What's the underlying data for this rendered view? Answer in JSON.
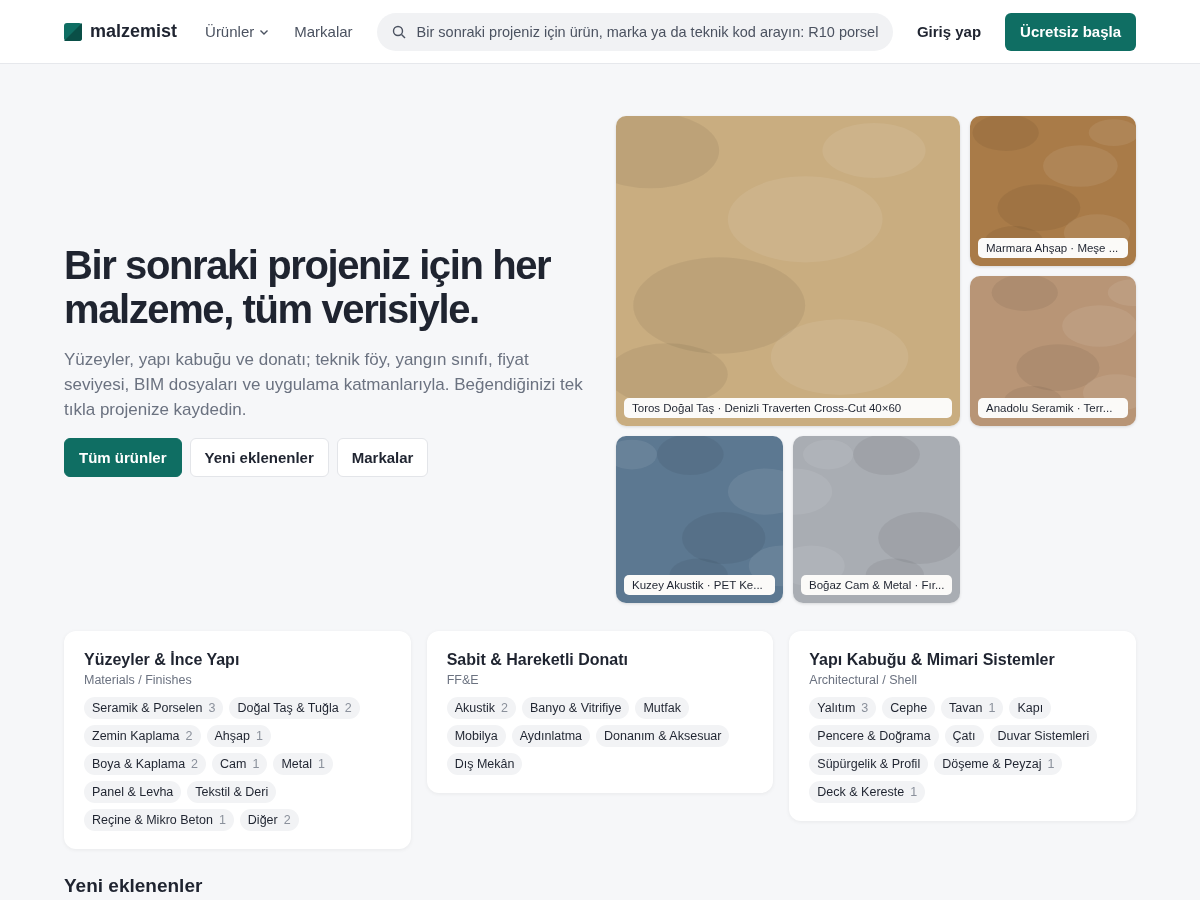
{
  "header": {
    "logo": "malzemist",
    "nav": [
      {
        "label": "Ürünler",
        "dropdown": true
      },
      {
        "label": "Markalar",
        "dropdown": false
      }
    ],
    "search": {
      "placeholder": "Bir sonraki projeniz için ürün, marka ya da teknik kod arayın: R10 porsel"
    },
    "login": "Giriş yap",
    "cta": "Ücretsiz başla"
  },
  "hero": {
    "title": "Bir sonraki projeniz için her malzeme, tüm verisiyle.",
    "text": "Yüzeyler, yapı kabuğu ve donatı; teknik föy, yangın sınıfı, fiyat seviyesi, BIM dosyaları ve uygulama katmanlarıyla. Beğendiğinizi tek tıkla projenize kaydedin.",
    "buttons": [
      {
        "label": "Tüm ürünler",
        "primary": true
      },
      {
        "label": "Yeni eklenenler",
        "primary": false
      },
      {
        "label": "Markalar",
        "primary": false
      }
    ]
  },
  "gallery": [
    {
      "kind": "picture",
      "caption": "Toros Doğal Taş · Denizli Traverten Cross-Cut 40×60"
    },
    {
      "kind": "picture",
      "caption": "Marmara Ahşap · Meşe ..."
    },
    {
      "kind": "picture",
      "caption": "Anadolu Seramik · Terr..."
    },
    {
      "kind": "picture",
      "caption": "Kuzey Akustik · PET Ke..."
    },
    {
      "kind": "picture",
      "caption": "Boğaz Cam & Metal · Fır..."
    }
  ],
  "categories": [
    {
      "title": "Yüzeyler & İnce Yapı",
      "subtitle": "Materials / Finishes",
      "tags": [
        {
          "label": "Seramik & Porselen",
          "count": "3"
        },
        {
          "label": "Doğal Taş & Tuğla",
          "count": "2"
        },
        {
          "label": "Zemin Kaplama",
          "count": "2"
        },
        {
          "label": "Ahşap",
          "count": "1"
        },
        {
          "label": "Boya & Kaplama",
          "count": "2"
        },
        {
          "label": "Cam",
          "count": "1"
        },
        {
          "label": "Metal",
          "count": "1"
        },
        {
          "label": "Panel & Levha"
        },
        {
          "label": "Tekstil & Deri"
        },
        {
          "label": "Reçine & Mikro Beton",
          "count": "1"
        },
        {
          "label": "Diğer",
          "count": "2"
        }
      ]
    },
    {
      "title": "Sabit & Hareketli Donatı",
      "subtitle": "FF&E",
      "tags": [
        {
          "label": "Akustik",
          "count": "2"
        },
        {
          "label": "Banyo & Vitrifiye"
        },
        {
          "label": "Mutfak"
        },
        {
          "label": "Mobilya"
        },
        {
          "label": "Aydınlatma"
        },
        {
          "label": "Donanım & Aksesuar"
        },
        {
          "label": "Dış Mekân"
        }
      ]
    },
    {
      "title": "Yapı Kabuğu & Mimari Sistemler",
      "subtitle": "Architectural / Shell",
      "tags": [
        {
          "label": "Yalıtım",
          "count": "3"
        },
        {
          "label": "Cephe"
        },
        {
          "label": "Tavan",
          "count": "1"
        },
        {
          "label": "Kapı"
        },
        {
          "label": "Pencere & Doğrama"
        },
        {
          "label": "Çatı"
        },
        {
          "label": "Duvar Sistemleri"
        },
        {
          "label": "Süpürgelik & Profil"
        },
        {
          "label": "Döşeme & Peyzaj",
          "count": "1"
        },
        {
          "label": "Deck & Kereste",
          "count": "1"
        }
      ]
    }
  ],
  "recent": {
    "title": "Yeni eklenenler"
  }
}
